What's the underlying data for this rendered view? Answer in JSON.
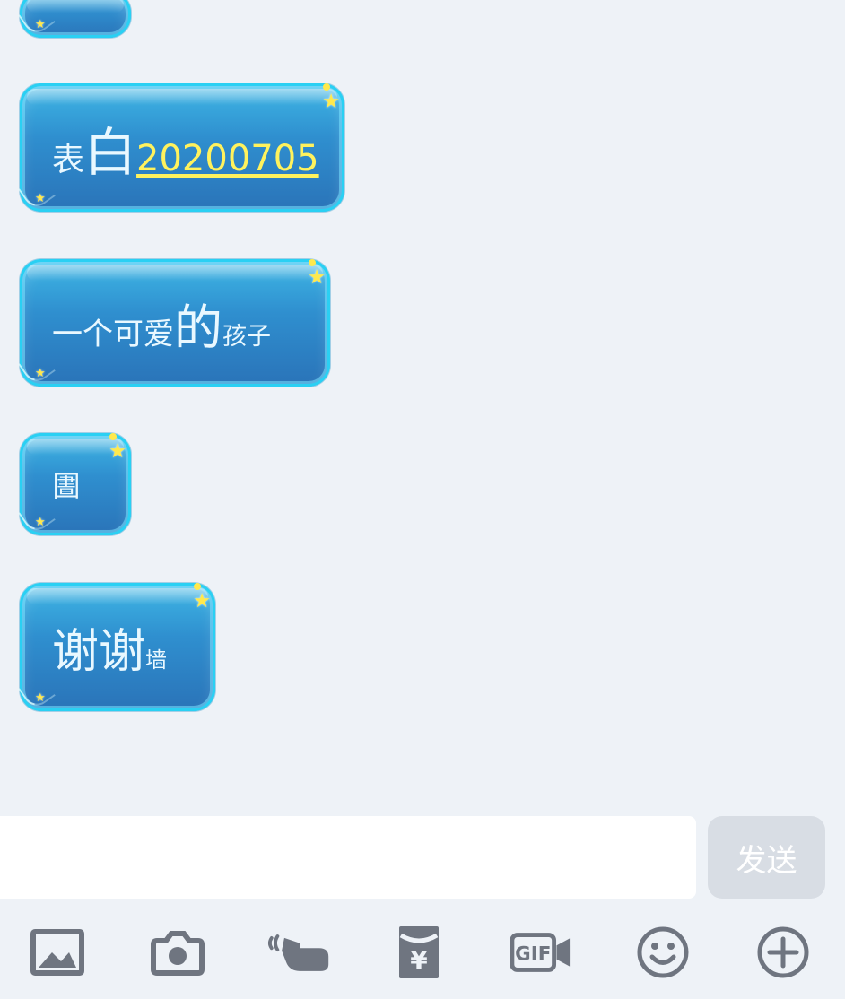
{
  "colors": {
    "page_background": "#eef2f7",
    "bubble_blue": "#2f8fcf",
    "bubble_glow": "#2ad0f3",
    "bubble_text": "#e9f8ff",
    "date_link": "#fff25d",
    "send_button_bg": "#d8dde4",
    "icon_gray": "#6f7580"
  },
  "messages": [
    {
      "segments": []
    },
    {
      "segments": [
        "表",
        "白",
        "20200705"
      ]
    },
    {
      "segments": [
        "一个可爱",
        "的",
        "孩子"
      ]
    },
    {
      "segments": [
        "圕"
      ]
    },
    {
      "segments": [
        "谢谢",
        "墙"
      ]
    }
  ],
  "composer": {
    "input_value": "",
    "input_placeholder": "",
    "send_label": "发送"
  },
  "toolbar": {
    "icons": [
      "image-icon",
      "camera-icon",
      "poke-icon",
      "red-packet-icon",
      "gif-icon",
      "emoji-icon",
      "plus-icon"
    ],
    "gif_label": "GIF",
    "currency_symbol": "¥"
  }
}
